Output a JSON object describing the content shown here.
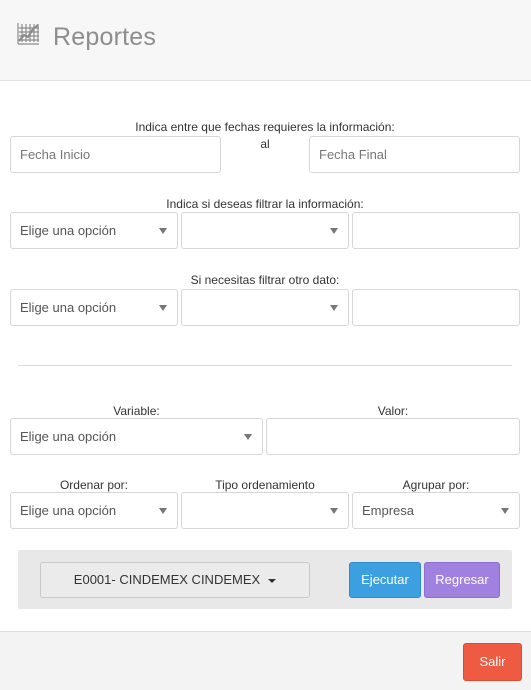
{
  "header": {
    "title": "Reportes",
    "icon": "chart-icon"
  },
  "dates": {
    "label": "Indica entre que fechas requieres la información:",
    "start_placeholder": "Fecha Inicio",
    "separator": "al",
    "end_placeholder": "Fecha Final"
  },
  "filter1": {
    "label": "Indica si deseas filtrar la información:",
    "select1": "Elige una opción",
    "select2": "",
    "input": ""
  },
  "filter2": {
    "label": "Si necesitas filtrar otro dato:",
    "select1": "Elige una opción",
    "select2": "",
    "input": ""
  },
  "variable": {
    "label": "Variable:",
    "select": "Elige una opción"
  },
  "valor": {
    "label": "Valor:",
    "input": ""
  },
  "ordenar": {
    "label": "Ordenar por:",
    "select": "Elige una opción"
  },
  "tipo": {
    "label": "Tipo ordenamiento",
    "select": ""
  },
  "agrupar": {
    "label": "Agrupar por:",
    "select": "Empresa"
  },
  "actions": {
    "company": "E0001- CINDEMEX CINDEMEX",
    "ejecutar": "Ejecutar",
    "regresar": "Regresar"
  },
  "footer": {
    "salir": "Salir"
  },
  "colors": {
    "ejecutar": "#3b9fe0",
    "regresar": "#a081e0",
    "salir": "#ef5b42"
  }
}
